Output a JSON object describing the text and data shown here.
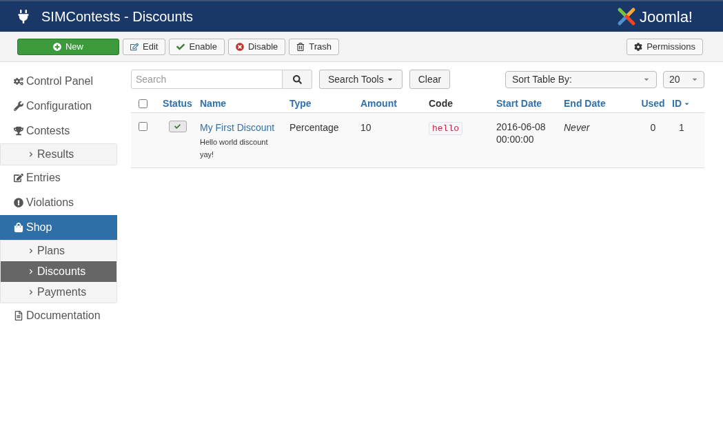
{
  "header": {
    "title": "SIMContests - Discounts",
    "logo_text": "Joomla!"
  },
  "toolbar": {
    "buttons": [
      {
        "label": "New",
        "kind": "primary"
      },
      {
        "label": "Edit",
        "kind": "default"
      },
      {
        "label": "Enable",
        "kind": "default"
      },
      {
        "label": "Disable",
        "kind": "default"
      },
      {
        "label": "Trash",
        "kind": "default"
      }
    ],
    "right_button": {
      "label": "Permissions"
    }
  },
  "sidebar": {
    "items": [
      {
        "label": "Control Panel",
        "selected": false
      },
      {
        "label": "Configuration",
        "selected": false
      },
      {
        "label": "Contests",
        "selected": false,
        "children": [
          {
            "label": "Results",
            "selected": false
          }
        ]
      },
      {
        "label": "Entries",
        "selected": false
      },
      {
        "label": "Violations",
        "selected": false
      },
      {
        "label": "Shop",
        "selected": true,
        "children": [
          {
            "label": "Plans",
            "selected": false
          },
          {
            "label": "Discounts",
            "selected": true
          },
          {
            "label": "Payments",
            "selected": false
          }
        ]
      },
      {
        "label": "Documentation",
        "selected": false
      }
    ]
  },
  "filters": {
    "search": {
      "placeholder": "Search"
    },
    "search_tools": "Search Tools",
    "clear": "Clear",
    "sort": "Sort Table By:",
    "limit": "20"
  },
  "table": {
    "select_all_checked": false,
    "columns": [
      {
        "label": "Status",
        "sortable": true,
        "sorted": false
      },
      {
        "label": "Name",
        "sortable": true,
        "sorted": false
      },
      {
        "label": "Type",
        "sortable": true,
        "sorted": false
      },
      {
        "label": "Amount",
        "sortable": true,
        "sorted": false
      },
      {
        "label": "Code",
        "sortable": false,
        "sorted": false
      },
      {
        "label": "Start Date",
        "sortable": true,
        "sorted": false
      },
      {
        "label": "End Date",
        "sortable": true,
        "sorted": false
      },
      {
        "label": "Used",
        "sortable": true,
        "sorted": false
      },
      {
        "label": "ID",
        "sortable": true,
        "sorted": true
      }
    ],
    "rows": [
      {
        "checked": false,
        "enabled": true,
        "name": "My First Discount",
        "description": "Hello world discount yay!",
        "type": "Percentage",
        "amount": "10",
        "code": "hello",
        "start_date": "2016-06-08 00:00:00",
        "end_date": "Never",
        "used": "0",
        "id": "1"
      }
    ]
  }
}
